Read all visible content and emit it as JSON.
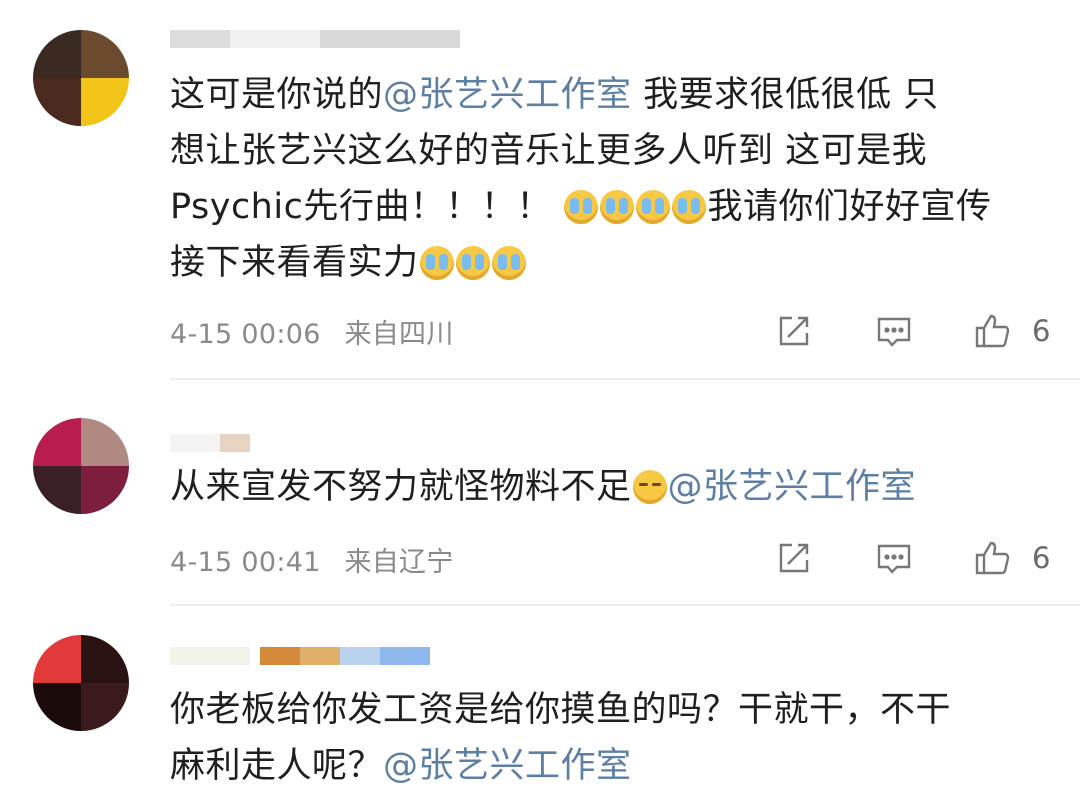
{
  "comments": [
    {
      "lines": [
        {
          "parts": [
            {
              "t": "这可是你说的"
            },
            {
              "m": "@张艺兴工作室"
            },
            {
              "t": "  我要求很低很低  只"
            }
          ]
        },
        {
          "parts": [
            {
              "t": "想让张艺兴这么好的音乐让更多人听到 这可是我"
            }
          ]
        },
        {
          "parts": [
            {
              "t": "Psychic先行曲！！！！ "
            },
            {
              "e": "crying-face"
            },
            {
              "e": "crying-face"
            },
            {
              "e": "crying-face"
            },
            {
              "e": "crying-face"
            },
            {
              "t": "我请你们好好宣传"
            }
          ]
        },
        {
          "parts": [
            {
              "t": "接下来看看实力"
            },
            {
              "e": "crying-face"
            },
            {
              "e": "crying-face"
            },
            {
              "e": "crying-face"
            }
          ]
        }
      ],
      "time": "4-15 00:06",
      "location": "来自四川",
      "likes": "6"
    },
    {
      "lines": [
        {
          "parts": [
            {
              "t": "从来宣发不努力就怪物料不足"
            },
            {
              "e": "sweat-face"
            },
            {
              "m": "@张艺兴工作室"
            }
          ]
        }
      ],
      "time": "4-15 00:41",
      "location": "来自辽宁",
      "likes": "6"
    },
    {
      "lines": [
        {
          "parts": [
            {
              "t": "你老板给你发工资是给你摸鱼的吗？干就干，不干"
            }
          ]
        },
        {
          "parts": [
            {
              "t": "麻利走人呢？"
            },
            {
              "m": "@张艺兴工作室"
            }
          ]
        }
      ]
    }
  ],
  "icons": {
    "share": "share-icon",
    "reply": "comment-icon",
    "like": "thumbs-up-icon"
  },
  "colors": {
    "mention": "#5d7fa3",
    "meta": "#8a8a8a",
    "divider": "#ececec"
  }
}
